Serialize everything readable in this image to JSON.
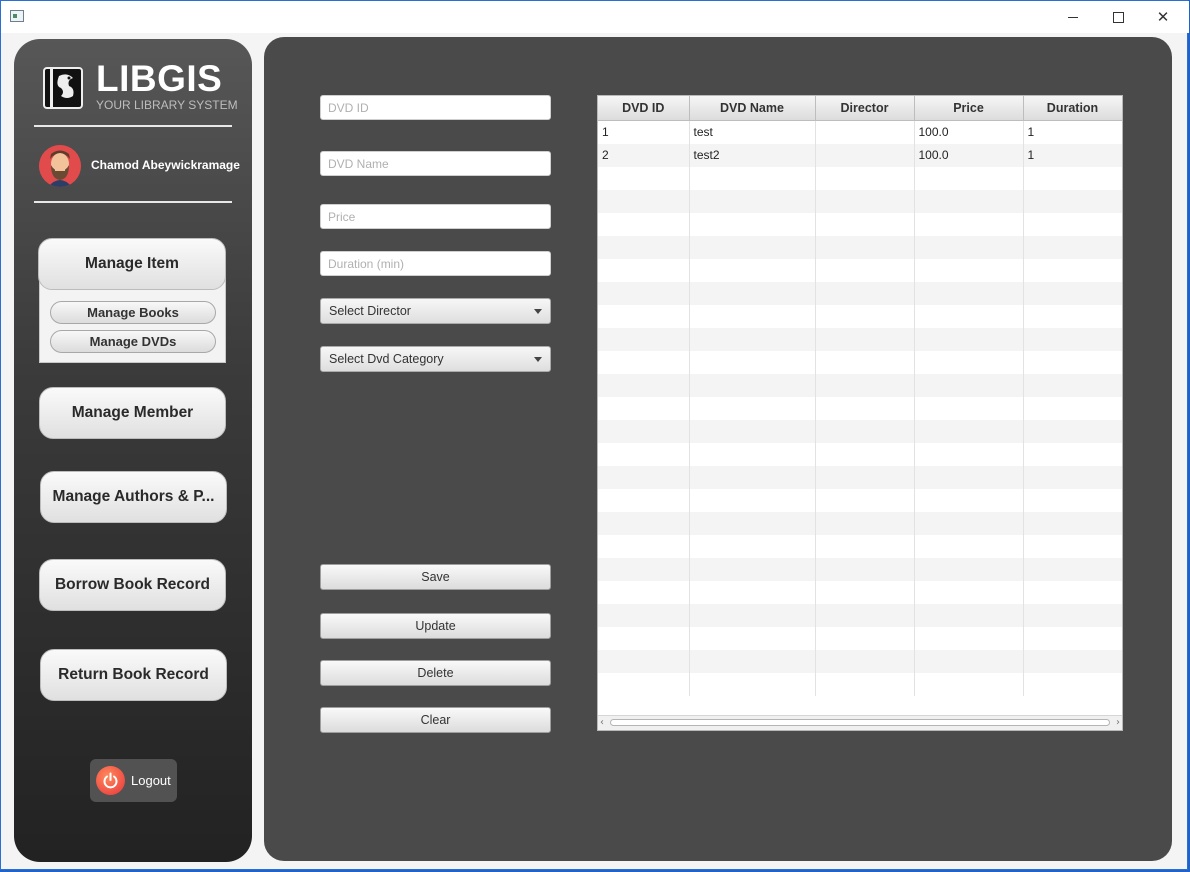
{
  "window": {
    "controls": {
      "minimize": "minimize-icon",
      "maximize": "maximize-icon",
      "close": "close-icon"
    }
  },
  "sidebar": {
    "logo": {
      "title": "LIBGIS",
      "subtitle": "YOUR LIBRARY SYSTEM"
    },
    "user": {
      "name": "Chamod Abeywickramage"
    },
    "nav": {
      "manage_item": "Manage Item",
      "manage_books": "Manage Books",
      "manage_dvds": "Manage DVDs",
      "manage_member": "Manage Member",
      "manage_authors": "Manage Authors & P...",
      "borrow_record": "Borrow Book Record",
      "return_record": "Return Book Record"
    },
    "logout": "Logout"
  },
  "form": {
    "dvd_id": {
      "placeholder": "DVD ID",
      "value": ""
    },
    "dvd_name": {
      "placeholder": "DVD Name",
      "value": ""
    },
    "price": {
      "placeholder": "Price",
      "value": ""
    },
    "duration": {
      "placeholder": "Duration (min)",
      "value": ""
    },
    "director_select": "Select Director",
    "category_select": "Select Dvd Category",
    "buttons": {
      "save": "Save",
      "update": "Update",
      "delete": "Delete",
      "clear": "Clear"
    }
  },
  "table": {
    "columns": [
      "DVD ID",
      "DVD Name",
      "Director",
      "Price",
      "Duration"
    ],
    "rows": [
      [
        "1",
        "test",
        "",
        "100.0",
        "1"
      ],
      [
        "2",
        "test2",
        "",
        "100.0",
        "1"
      ]
    ]
  },
  "colors": {
    "sidebar": "#3b3b3b",
    "main_panel": "#4a4a4a",
    "logout_icon": "#e8343a"
  }
}
